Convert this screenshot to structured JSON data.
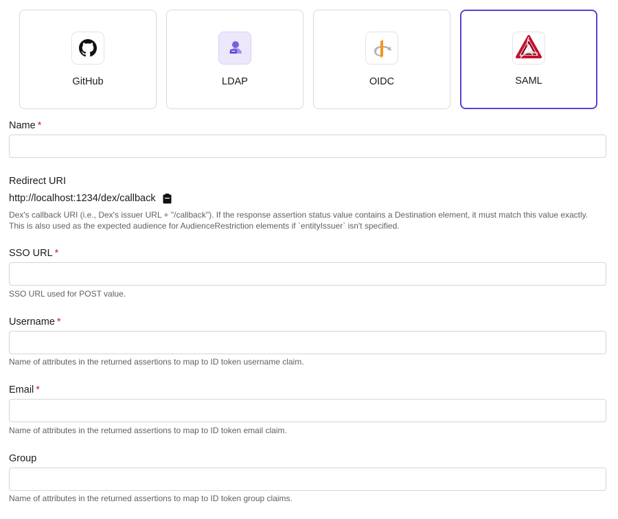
{
  "providers": [
    {
      "name": "GitHub",
      "icon": "github-icon",
      "selected": false
    },
    {
      "name": "LDAP",
      "icon": "ldap-user-icon",
      "selected": false
    },
    {
      "name": "OIDC",
      "icon": "openid-icon",
      "selected": false
    },
    {
      "name": "SAML",
      "icon": "saml-logo-icon",
      "selected": true
    }
  ],
  "form": {
    "name": {
      "label": "Name",
      "required_mark": "*",
      "value": ""
    },
    "redirect_uri": {
      "label": "Redirect URI",
      "value": "http://localhost:1234/dex/callback",
      "help_line1": "Dex's callback URI (i.e., Dex's issuer URL + \"/callback\"). If the response assertion status value contains a Destination element, it must match this value exactly.",
      "help_line2": "This is also used as the expected audience for AudienceRestriction elements if `entityIssuer` isn't specified."
    },
    "sso_url": {
      "label": "SSO URL",
      "required_mark": "*",
      "value": "",
      "help": "SSO URL used for POST value."
    },
    "username": {
      "label": "Username",
      "required_mark": "*",
      "value": "",
      "help": "Name of attributes in the returned assertions to map to ID token username claim."
    },
    "email": {
      "label": "Email",
      "required_mark": "*",
      "value": "",
      "help": "Name of attributes in the returned assertions to map to ID token email claim."
    },
    "group": {
      "label": "Group",
      "value": "",
      "help": "Name of attributes in the returned assertions to map to ID token group claims."
    }
  },
  "colors": {
    "accent": "#5b3fd6",
    "required": "#d11a2a",
    "help_text": "#5f5f66"
  }
}
